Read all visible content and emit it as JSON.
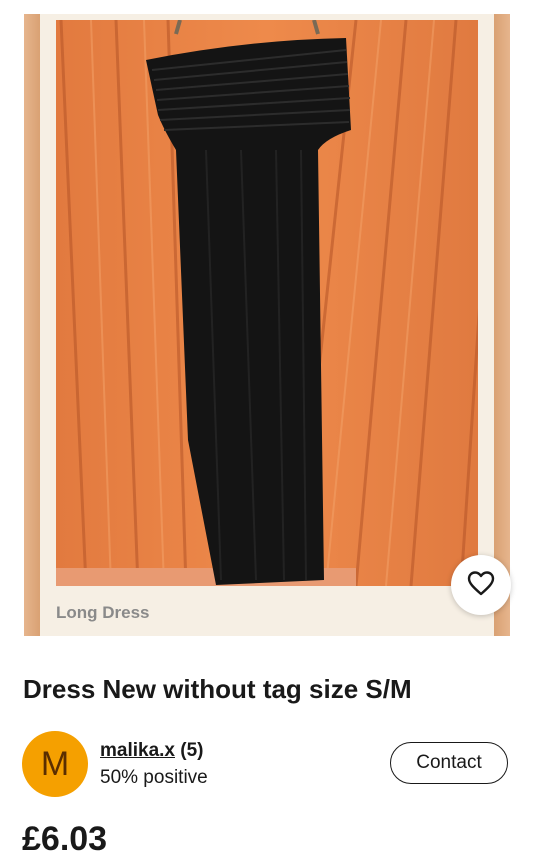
{
  "listing": {
    "image_caption": "Long Dress",
    "title": "Dress New without tag size S/M",
    "price": "£6.03",
    "watch_icon": "heart-icon"
  },
  "seller": {
    "avatar_letter": "M",
    "avatar_color": "#f5a000",
    "name": "malika.x",
    "feedback_count": "(5)",
    "feedback": "50% positive",
    "contact_label": "Contact"
  }
}
